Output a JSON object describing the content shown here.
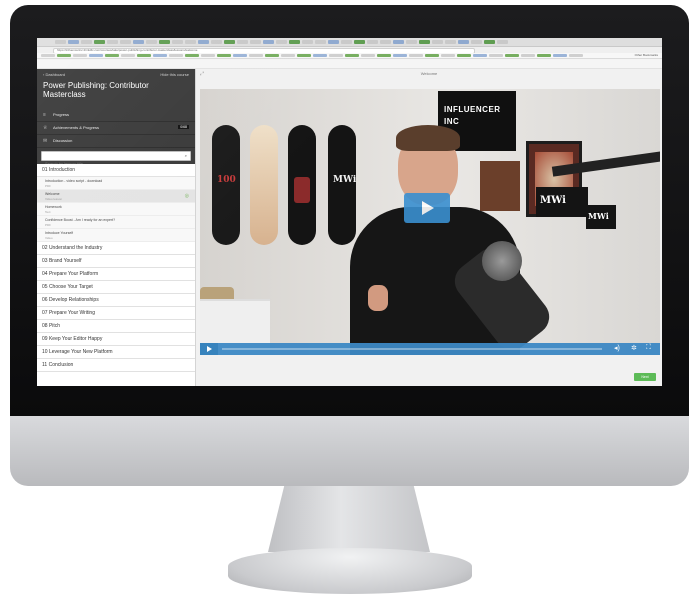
{
  "browser": {
    "url": "https://influencerinc.thinkific.com/courses/take/power-publishing-contributor-masterclass/lessons/welcome",
    "bookmarks_label": "Other Bookmarks"
  },
  "preview_bar": {
    "text": "You are currently in Preview Mode.",
    "link": "Return to the Course Builder"
  },
  "sidebar": {
    "back_label": "Dashboard",
    "hide_label": "Hide this course",
    "course_title": "Power Publishing: Contributor Masterclass",
    "rows": [
      {
        "label": "Progress",
        "icon": "bars-icon"
      },
      {
        "label": "Achievements & Progress",
        "badge": "0/68"
      },
      {
        "label": "Discussion",
        "icon": "chat-icon"
      }
    ],
    "search_placeholder": "Search by lesson title",
    "sections": [
      "02 Understand the Industry",
      "03 Brand Yourself",
      "04 Prepare Your Platform",
      "05 Choose Your Target",
      "06 Develop Relationships",
      "07 Prepare Your Writing",
      "08 Pitch",
      "09 Keep Your Editor Happy",
      "10 Leverage Your New Platform",
      "11 Conclusion"
    ],
    "intro_section": "01 Introduction",
    "lessons": [
      {
        "title": "Introduction - video script - download",
        "meta": "PDF"
      },
      {
        "title": "Welcome",
        "meta": "Video lesson",
        "active": true
      },
      {
        "title": "Homework",
        "meta": "Text"
      },
      {
        "title": "Confidence Boost - Am I ready for an expert?",
        "meta": "PDF"
      },
      {
        "title": "Introduce Yourself",
        "meta": "Video"
      }
    ]
  },
  "main": {
    "lesson_title": "Welcome",
    "complete_label": "Next",
    "video": {
      "sign_line1": "INFLUENCER",
      "sign_line2": "INC",
      "mic_label": "MWi",
      "mic_label2": "MWi",
      "board_text": "MWi",
      "board2_text": "100",
      "progress": 0
    }
  }
}
